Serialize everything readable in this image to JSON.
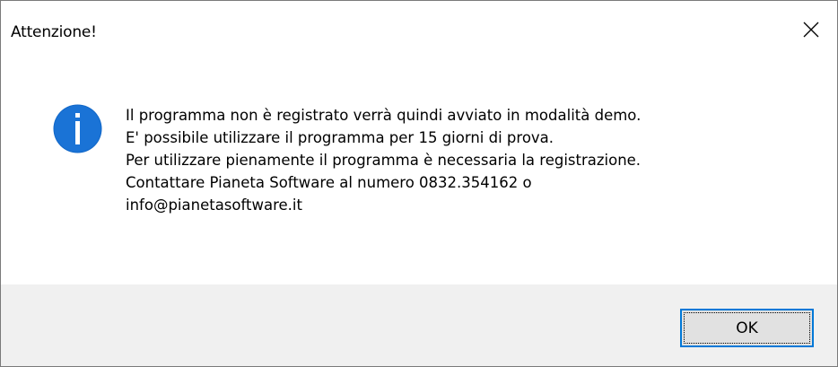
{
  "window": {
    "title": "Attenzione!",
    "close_icon": "close-icon"
  },
  "message": {
    "icon": "info-icon",
    "icon_color": "#1167c8",
    "lines": [
      "Il programma non è registrato verrà quindi avviato in modalità demo.",
      "E' possibile utilizzare il programma per 15 giorni di prova.",
      "Per utilizzare pienamente il programma è necessaria la registrazione.",
      "Contattare Pianeta Software al numero 0832.354162 o",
      "info@pianetasoftware.it"
    ]
  },
  "buttons": {
    "ok_label": "OK",
    "focus_color": "#0078d7"
  }
}
